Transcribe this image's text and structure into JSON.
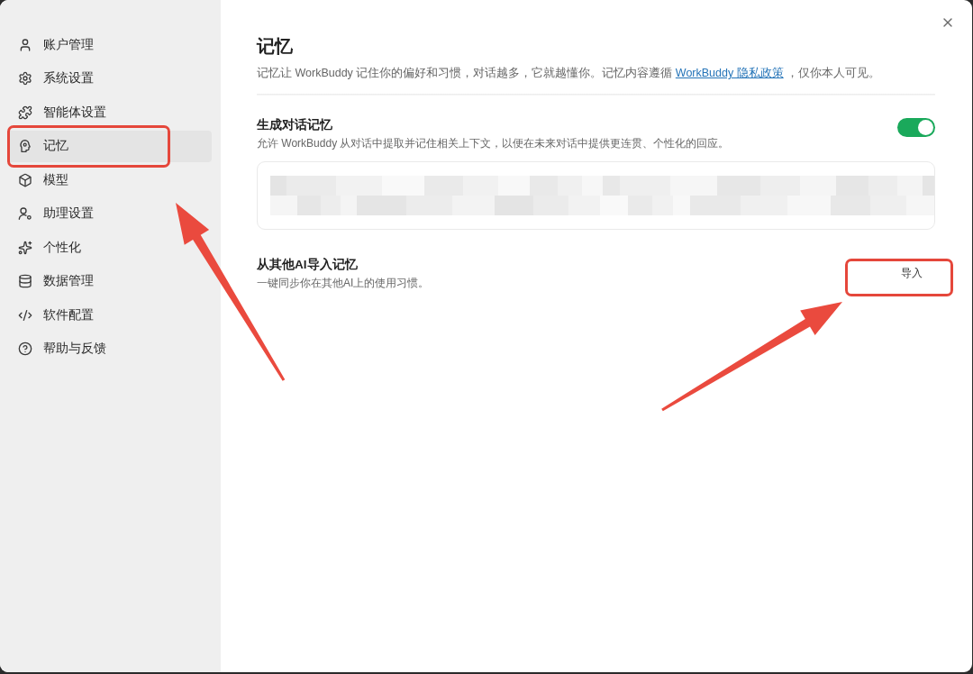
{
  "sidebar": {
    "items": [
      {
        "label": "账户管理",
        "selected": false,
        "highlighted": false
      },
      {
        "label": "系统设置",
        "selected": false,
        "highlighted": false
      },
      {
        "label": "智能体设置",
        "selected": false,
        "highlighted": false
      },
      {
        "label": "记忆",
        "selected": true,
        "highlighted": true
      },
      {
        "label": "模型",
        "selected": false,
        "highlighted": false
      },
      {
        "label": "助理设置",
        "selected": false,
        "highlighted": false
      },
      {
        "label": "个性化",
        "selected": false,
        "highlighted": false
      },
      {
        "label": "数据管理",
        "selected": false,
        "highlighted": false
      },
      {
        "label": "软件配置",
        "selected": false,
        "highlighted": false
      },
      {
        "label": "帮助与反馈",
        "selected": false,
        "highlighted": false
      }
    ]
  },
  "page": {
    "title": "记忆",
    "description": {
      "text_before": "记忆让 WorkBuddy 记住你的偏好和习惯，对话越多，它就越懂你。记忆内容遵循 ",
      "link": "WorkBuddy 隐私政策",
      "text_after": " ，仅你本人可见。"
    }
  },
  "sections": [
    {
      "kind": "toggle",
      "title": "生成对话记忆",
      "description": "允许 WorkBuddy 从对话中提取并记住相关上下文，以便在未来对话中提供更连贯、个性化的回应。",
      "on": true,
      "memory_box": {
        "blurred": true
      }
    },
    {
      "kind": "action",
      "title": "从其他AI导入记忆",
      "description": "一键同步你在其他AI上的使用习惯。",
      "button": "导入",
      "highlighted": true
    }
  ]
}
